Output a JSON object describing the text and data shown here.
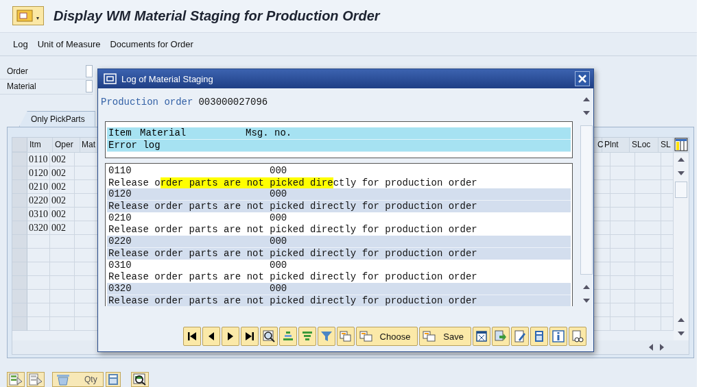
{
  "window": {
    "title": "Display WM Material Staging for Production Order"
  },
  "menu": [
    "Log",
    "Unit of Measure",
    "Documents for Order"
  ],
  "fields": [
    {
      "label": "Order"
    },
    {
      "label": "Material"
    }
  ],
  "tabs": [
    {
      "label": "Only PickParts",
      "selected": true
    }
  ],
  "table": {
    "columns": [
      "Itm",
      "Oper",
      "Mat",
      "C",
      "Plnt",
      "SLoc",
      "SL"
    ],
    "rows": [
      {
        "item": "0110",
        "operation": "002"
      },
      {
        "item": "0120",
        "operation": "002"
      },
      {
        "item": "0210",
        "operation": "002"
      },
      {
        "item": "0220",
        "operation": "002"
      },
      {
        "item": "0310",
        "operation": "002"
      },
      {
        "item": "0320",
        "operation": "002"
      }
    ]
  },
  "bottom_toolbar": {
    "qty_button": "Qty"
  },
  "dialog": {
    "title": "Log of Material Staging",
    "order_label": "Production order",
    "order_number": "003000027096",
    "header": {
      "item": "Item",
      "material": "Material",
      "msg_no": "Msg. no.",
      "error_log": "Error log"
    },
    "entries": [
      {
        "item": "0110",
        "msg_no": "000",
        "message": [
          {
            "text": "Release o",
            "highlighted": false
          },
          {
            "text": "rder parts are not picked dire",
            "highlighted": true
          },
          {
            "text": "ctly for production order",
            "highlighted": false
          }
        ]
      },
      {
        "item": "0120",
        "msg_no": "000",
        "message": [
          {
            "text": "Release order parts are not picked directly for production order",
            "highlighted": false
          }
        ]
      },
      {
        "item": "0210",
        "msg_no": "000",
        "message": [
          {
            "text": "Release order parts are not picked directly for production order",
            "highlighted": false
          }
        ]
      },
      {
        "item": "0220",
        "msg_no": "000",
        "message": [
          {
            "text": "Release order parts are not picked directly for production order",
            "highlighted": false
          }
        ]
      },
      {
        "item": "0310",
        "msg_no": "000",
        "message": [
          {
            "text": "Release order parts are not picked directly for production order",
            "highlighted": false
          }
        ]
      },
      {
        "item": "0320",
        "msg_no": "000",
        "message": [
          {
            "text": "Release order parts are not picked directly for production order",
            "highlighted": false
          }
        ]
      }
    ],
    "buttons": [
      "Choose",
      "Save"
    ]
  }
}
